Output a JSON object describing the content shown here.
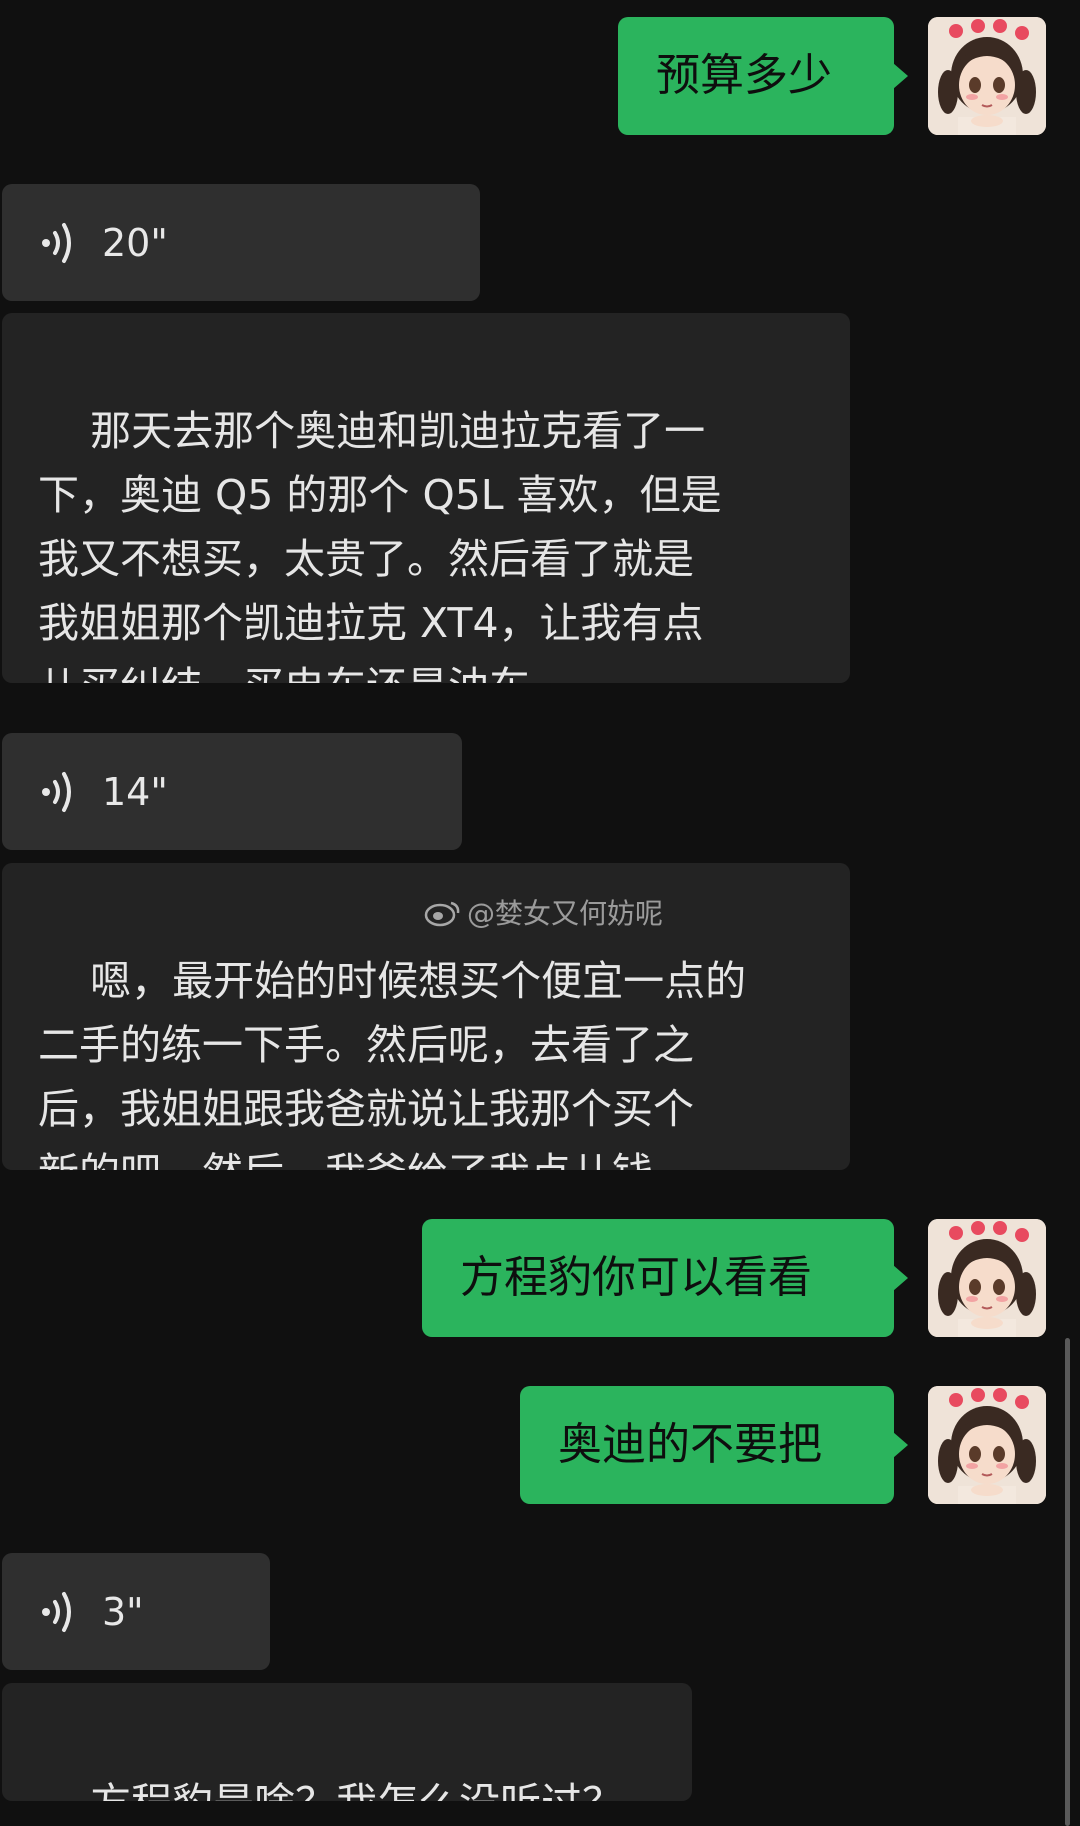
{
  "messages": {
    "out1": "预算多少",
    "voice1": "20\"",
    "text1": "那天去那个奥迪和凯迪拉克看了一\n下，奥迪 Q5 的那个 Q5L 喜欢，但是\n我又不想买，太贵了。然后看了就是\n我姐姐那个凯迪拉克 XT4，让我有点\n儿买纠结，买电车还是油车。",
    "voice2": "14\"",
    "text2": "嗯，最开始的时候想买个便宜一点的\n二手的练一下手。然后呢，去看了之\n后，我姐姐跟我爸就说让我那个买个\n新的吧。然后，我爸给了我点儿钱。",
    "out2": "方程豹你可以看看",
    "out3": "奥迪的不要把",
    "voice3": "3\"",
    "text3": "方程豹是啥？我怎么没听过？"
  },
  "watermark": {
    "text": "@婪女又何妨呢"
  },
  "colors": {
    "background": "#101010",
    "outgoing_bubble": "#2bb45d",
    "voice_bubble": "#2f2f2f",
    "text_bubble": "#232323"
  },
  "icons": {
    "voice": "voice-wave-icon",
    "avatar": "anime-girl-avatar",
    "watermark": "weibo-logo-icon"
  }
}
